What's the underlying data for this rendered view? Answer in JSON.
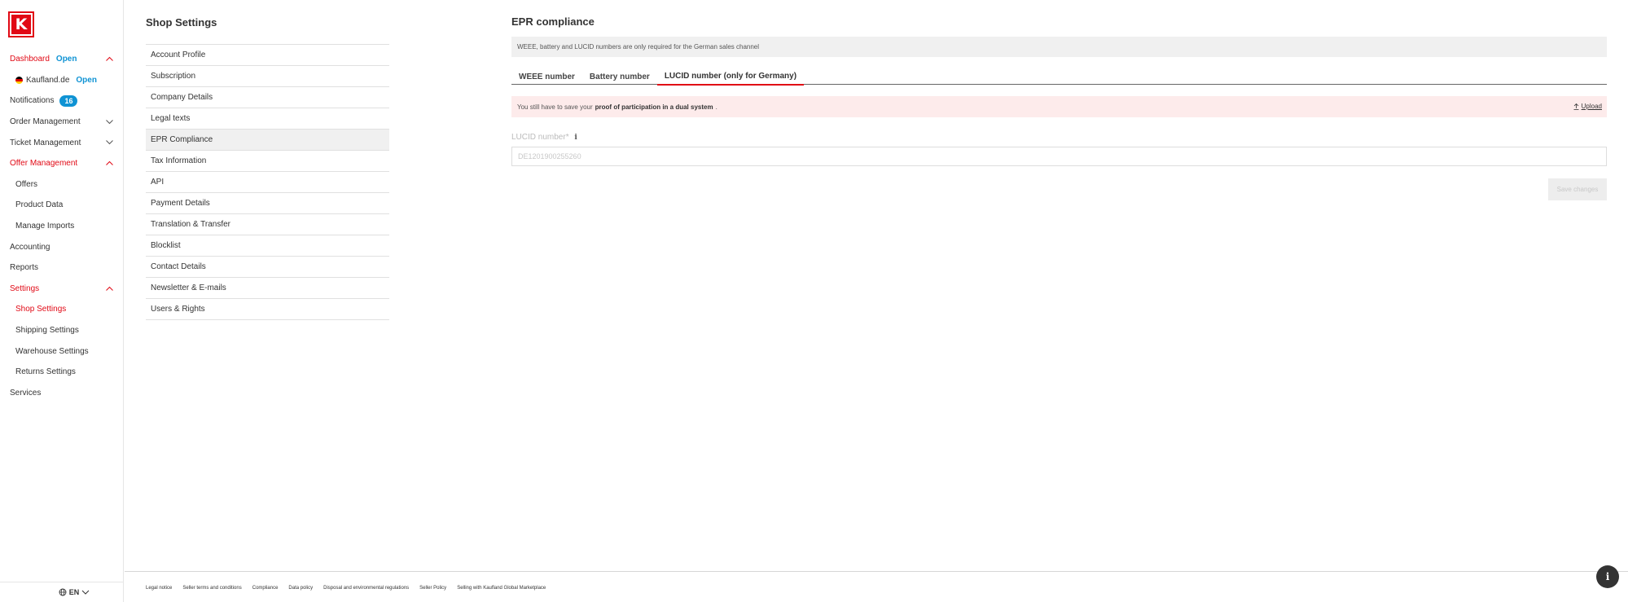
{
  "brand": {
    "logo_letter": "K",
    "color": "#e10915"
  },
  "colors": {
    "accent": "#e10915",
    "info": "#0f93d4"
  },
  "sidebar": {
    "items": [
      {
        "label": "Dashboard",
        "status": "Open",
        "chevron": "up",
        "red": true
      },
      {
        "label": "Kaufland.de",
        "status": "Open",
        "flag": "de-flag-icon",
        "sub": true
      },
      {
        "label": "Notifications",
        "badge": "16"
      },
      {
        "label": "Order Management",
        "chevron": "down"
      },
      {
        "label": "Ticket Management",
        "chevron": "down"
      },
      {
        "label": "Offer Management",
        "chevron": "up",
        "red": true
      },
      {
        "label": "Offers",
        "sub": true
      },
      {
        "label": "Product Data",
        "sub": true
      },
      {
        "label": "Manage Imports",
        "sub": true
      },
      {
        "label": "Accounting"
      },
      {
        "label": "Reports"
      },
      {
        "label": "Settings",
        "chevron": "up",
        "red": true
      },
      {
        "label": "Shop Settings",
        "sub": true,
        "red": true
      },
      {
        "label": "Shipping Settings",
        "sub": true
      },
      {
        "label": "Warehouse Settings",
        "sub": true
      },
      {
        "label": "Returns Settings",
        "sub": true
      },
      {
        "label": "Services"
      }
    ],
    "language": "EN"
  },
  "settings": {
    "title": "Shop Settings",
    "items": [
      "Account Profile",
      "Subscription",
      "Company Details",
      "Legal texts",
      "EPR Compliance",
      "Tax Information",
      "API",
      "Payment Details",
      "Translation & Transfer",
      "Blocklist",
      "Contact Details",
      "Newsletter & E-mails",
      "Users & Rights"
    ],
    "active_index": 4
  },
  "main": {
    "title": "EPR compliance",
    "info_text": "WEEE, battery and LUCID numbers are only required for the German sales channel",
    "tabs": [
      {
        "label": "WEEE number",
        "active": false
      },
      {
        "label": "Battery number",
        "active": false
      },
      {
        "label": "LUCID number (only for Germany)",
        "active": true
      }
    ],
    "alert": {
      "prefix": "You still have to save your",
      "bold": "proof of participation in a dual system",
      "suffix": ".",
      "upload_label": "Upload"
    },
    "field": {
      "label": "LUCID number*",
      "placeholder": "DE1201900255260",
      "value": ""
    },
    "save_label": "Save changes"
  },
  "footer": {
    "links": [
      "Legal notice",
      "Seller terms and conditions",
      "Compliance",
      "Data policy",
      "Disposal and environmental regulations",
      "Seller Policy",
      "Selling with Kaufland Global Marketplace"
    ],
    "help_label": "i"
  }
}
